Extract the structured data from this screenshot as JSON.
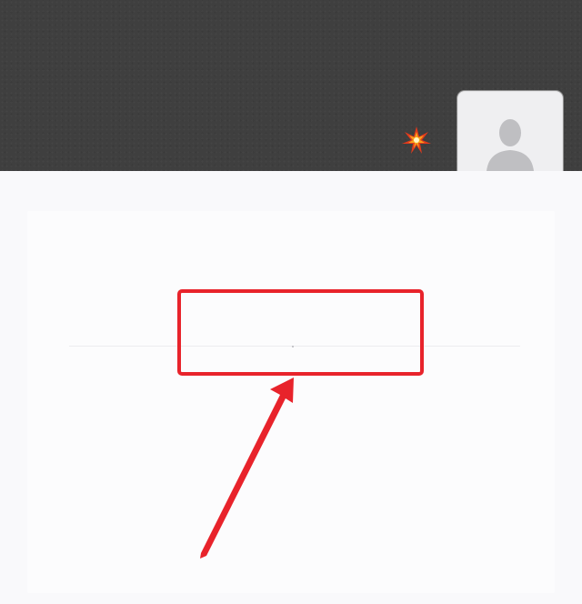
{
  "profile_header": {
    "banner_color": "#3f3f3f",
    "sparkle_icon": "sparkle-icon",
    "avatar_icon": "default-person-icon"
  },
  "annotation": {
    "highlight_color": "#e8232b",
    "highlight_icon": "highlight-box",
    "pointer_icon": "arrow-pointer"
  }
}
